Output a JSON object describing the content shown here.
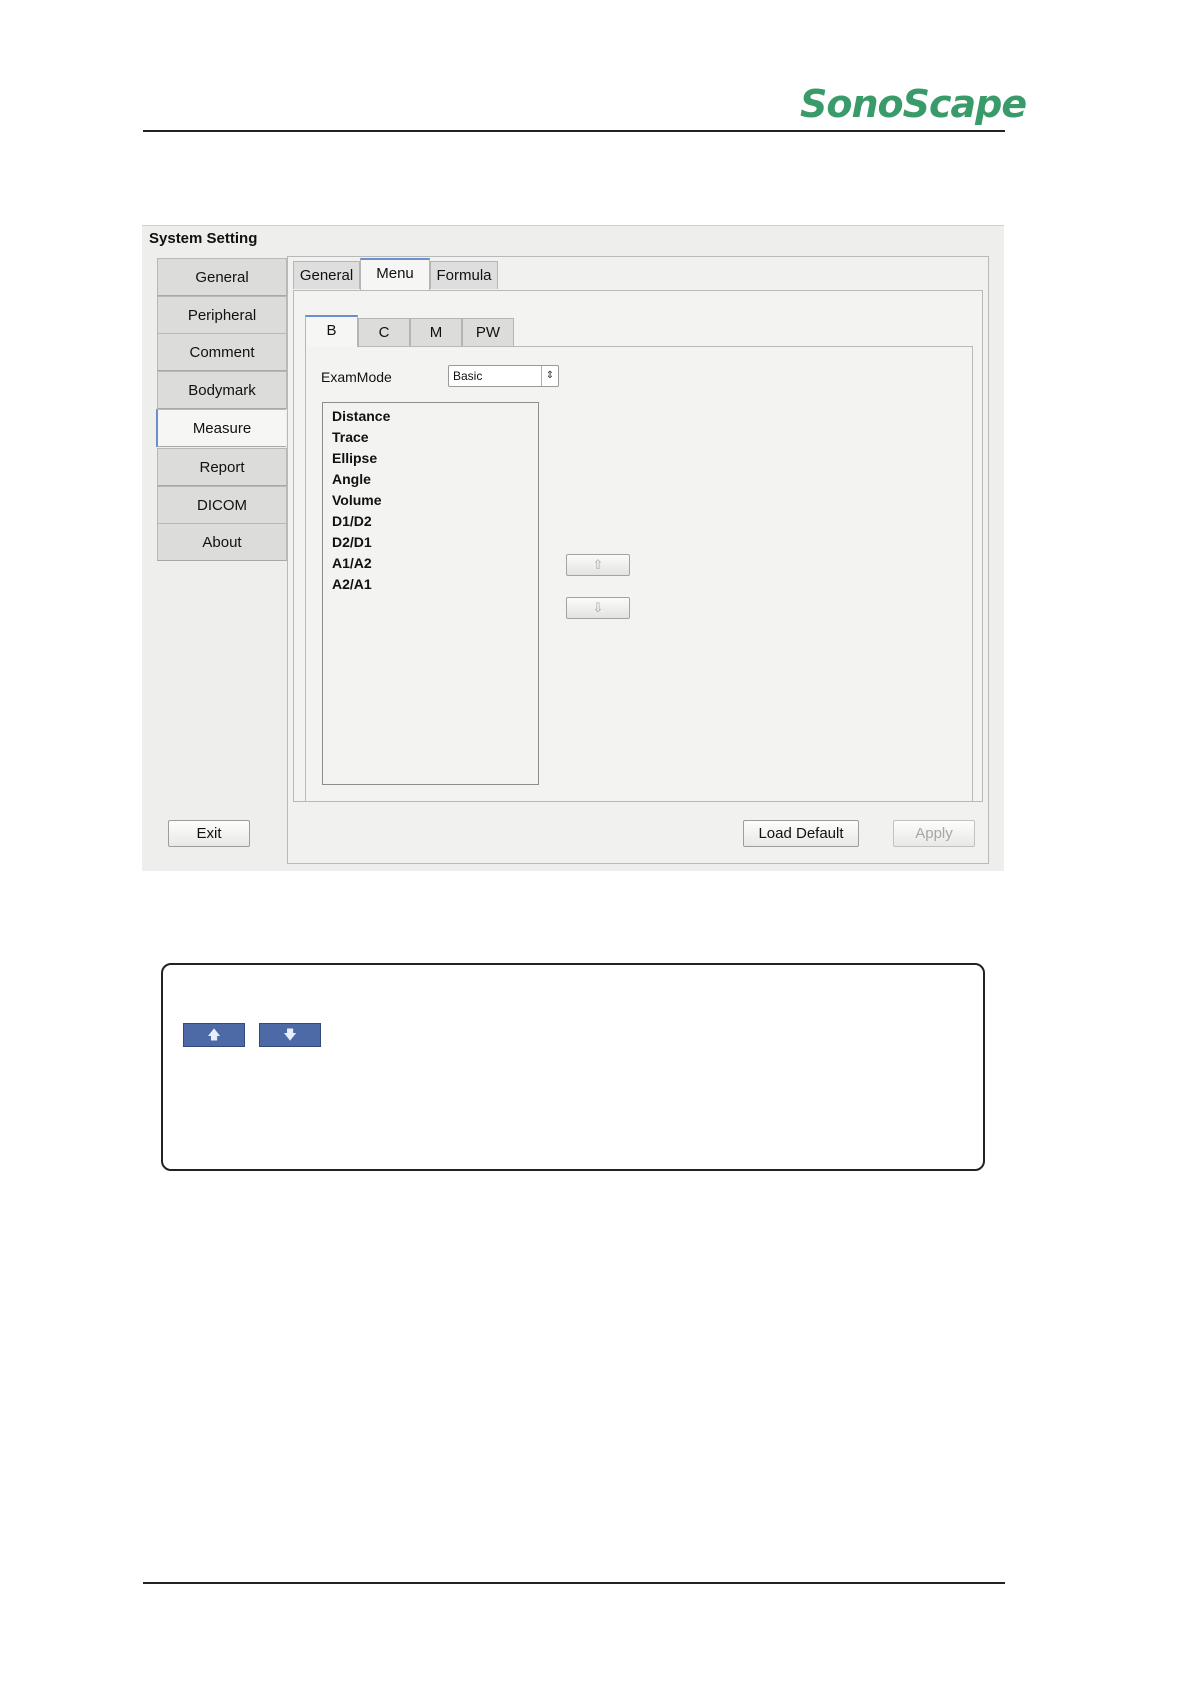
{
  "brand": {
    "logo_text": "SonoScape"
  },
  "window": {
    "title": "System Setting",
    "sidebar": [
      "General",
      "Peripheral",
      "Comment",
      "Bodymark",
      "Measure",
      "Report",
      "DICOM",
      "About"
    ],
    "tabs": [
      "General",
      "Menu",
      "Formula"
    ],
    "sub_tabs": [
      "B",
      "C",
      "M",
      "PW"
    ],
    "exam_mode": {
      "label": "ExamMode",
      "value": "Basic"
    },
    "measure_items": [
      "Distance",
      "Trace",
      "Ellipse",
      "Angle",
      "Volume",
      "D1/D2",
      "D2/D1",
      "A1/A2",
      "A2/A1"
    ],
    "buttons": {
      "exit": "Exit",
      "load_default": "Load Default",
      "apply": "Apply"
    }
  },
  "icons": {
    "move_up": "arrow-up-icon",
    "move_down": "arrow-down-icon",
    "up_glyph": "⇧",
    "down_glyph": "⇩",
    "chip_up_glyph": "🡅",
    "chip_down_glyph": "🡇"
  },
  "colors": {
    "brand_green": "#3a9b6a",
    "active_tab_accent": "#6a8fcf",
    "note_button_blue": "#4e6aa6"
  }
}
